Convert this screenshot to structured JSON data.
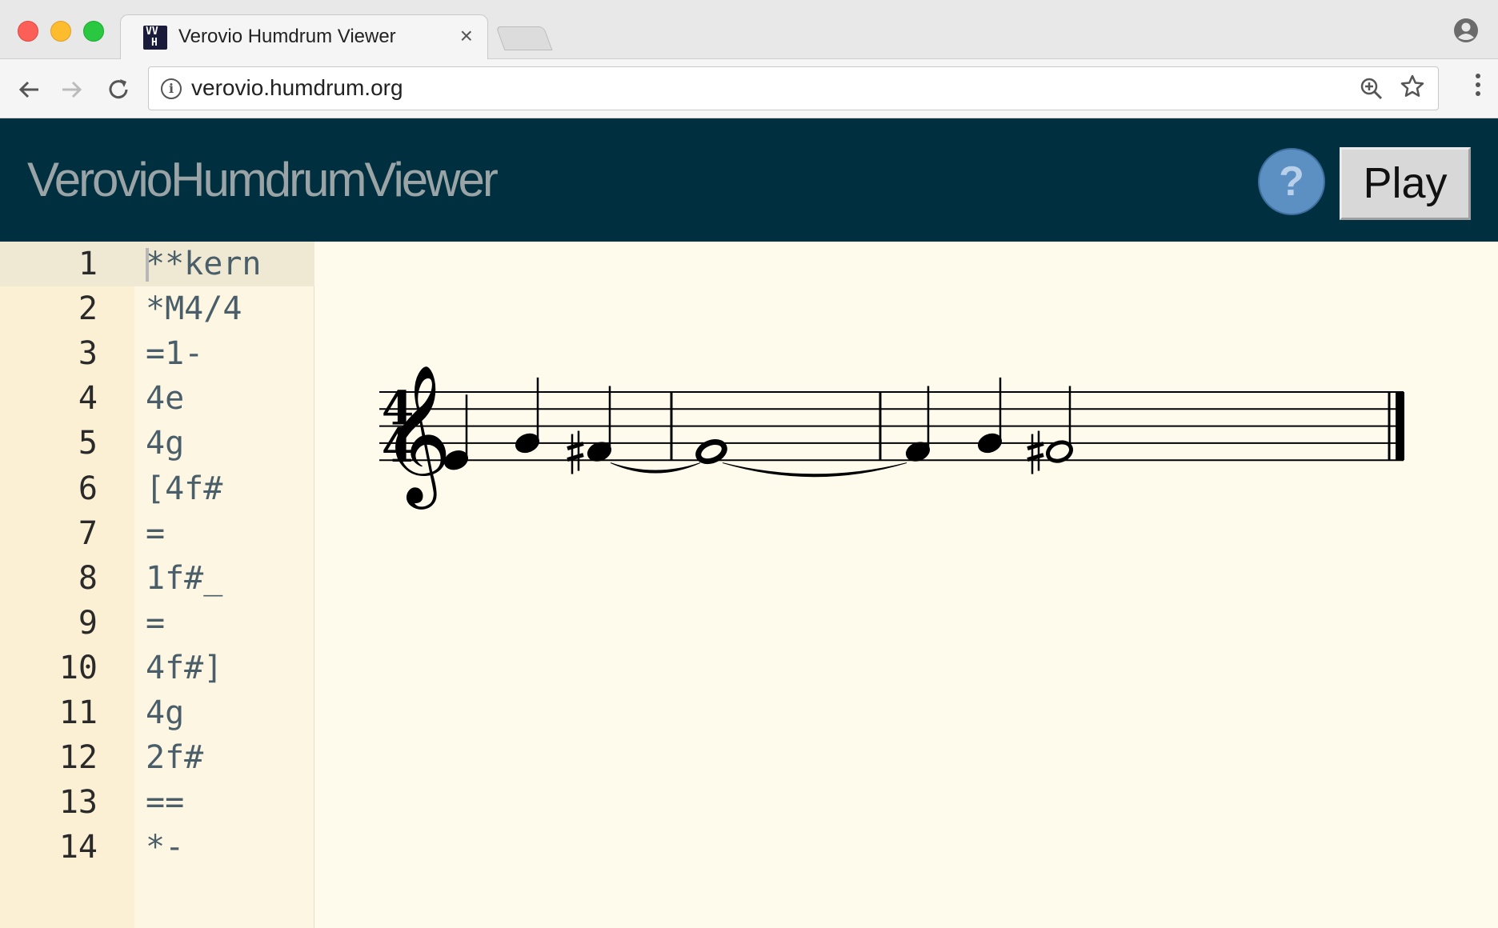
{
  "browser": {
    "tab_title": "Verovio Humdrum Viewer",
    "tab_favicon_top": "VV",
    "tab_favicon_bottom": "H",
    "tab_close_glyph": "×",
    "url": "verovio.humdrum.org",
    "icons": {
      "back": "arrow-left-icon",
      "forward": "arrow-right-icon",
      "reload": "reload-icon",
      "info": "info-icon",
      "zoom": "zoom-in-icon",
      "bookmark": "star-icon",
      "menu": "more-vert-icon",
      "profile": "account-icon"
    }
  },
  "app": {
    "title": "VerovioHumdrumViewer",
    "help_label": "?",
    "play_label": "Play"
  },
  "editor": {
    "lines": [
      {
        "num": "1",
        "text": "**kern"
      },
      {
        "num": "2",
        "text": "*M4/4"
      },
      {
        "num": "3",
        "text": "=1-"
      },
      {
        "num": "4",
        "text": "4e"
      },
      {
        "num": "5",
        "text": "4g"
      },
      {
        "num": "6",
        "text": "[4f#"
      },
      {
        "num": "7",
        "text": "="
      },
      {
        "num": "8",
        "text": "1f#_"
      },
      {
        "num": "9",
        "text": "="
      },
      {
        "num": "10",
        "text": "4f#]"
      },
      {
        "num": "11",
        "text": "4g"
      },
      {
        "num": "12",
        "text": "2f#"
      },
      {
        "num": "13",
        "text": "=="
      },
      {
        "num": "14",
        "text": "*-"
      }
    ]
  },
  "score": {
    "time_signature": {
      "top": "4",
      "bottom": "4"
    },
    "clef": "treble",
    "notes": [
      {
        "pitch": "E4",
        "duration": "quarter",
        "accidental": ""
      },
      {
        "pitch": "G4",
        "duration": "quarter",
        "accidental": ""
      },
      {
        "pitch": "F#4",
        "duration": "quarter",
        "accidental": "sharp",
        "tie_start": true
      },
      {
        "pitch": "F#4",
        "duration": "whole",
        "accidental": "",
        "tie_start": true
      },
      {
        "pitch": "F#4",
        "duration": "quarter",
        "accidental": ""
      },
      {
        "pitch": "G4",
        "duration": "quarter",
        "accidental": ""
      },
      {
        "pitch": "F#4",
        "duration": "half",
        "accidental": "sharp"
      }
    ],
    "barlines": [
      "single",
      "single",
      "final"
    ]
  }
}
